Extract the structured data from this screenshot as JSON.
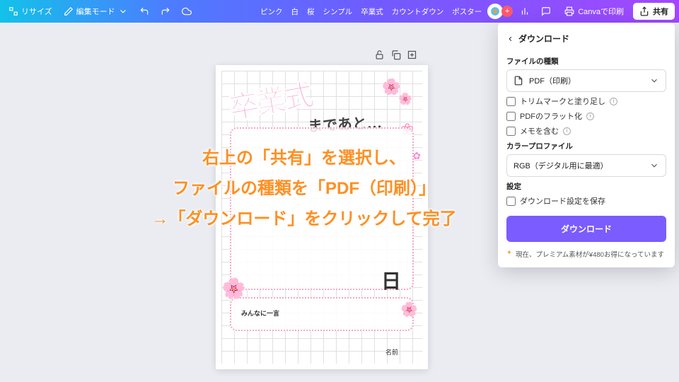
{
  "topbar": {
    "resize": "リサイズ",
    "edit_mode": "編集モード",
    "tags": [
      "ピンク",
      "白",
      "桜",
      "シンプル",
      "卒業式",
      "カウントダウン",
      "ポスター"
    ],
    "print": "Canvaで印刷",
    "share": "共有"
  },
  "artboard": {
    "title": "卒業式",
    "subtitle": "まであと…",
    "day_unit": "日",
    "memo_label": "みんなに一言",
    "name_label": "名前"
  },
  "panel": {
    "header": "ダウンロード",
    "file_type_label": "ファイルの種類",
    "file_type_value": "PDF（印刷）",
    "opt_trim": "トリムマークと塗り足し",
    "opt_flatten": "PDFのフラット化",
    "opt_notes": "メモを含む",
    "color_profile_label": "カラープロファイル",
    "color_profile_value": "RGB（デジタル用に最適）",
    "settings_label": "設定",
    "opt_save": "ダウンロード設定を保存",
    "download_btn": "ダウンロード",
    "promo": "現在、プレミアム素材が¥480お得になっています"
  },
  "overlay": {
    "line1": "右上の「共有」を選択し、",
    "line2": "ファイルの種類を「PDF（印刷）」",
    "line3": "→「ダウンロード」をクリックして完了"
  }
}
